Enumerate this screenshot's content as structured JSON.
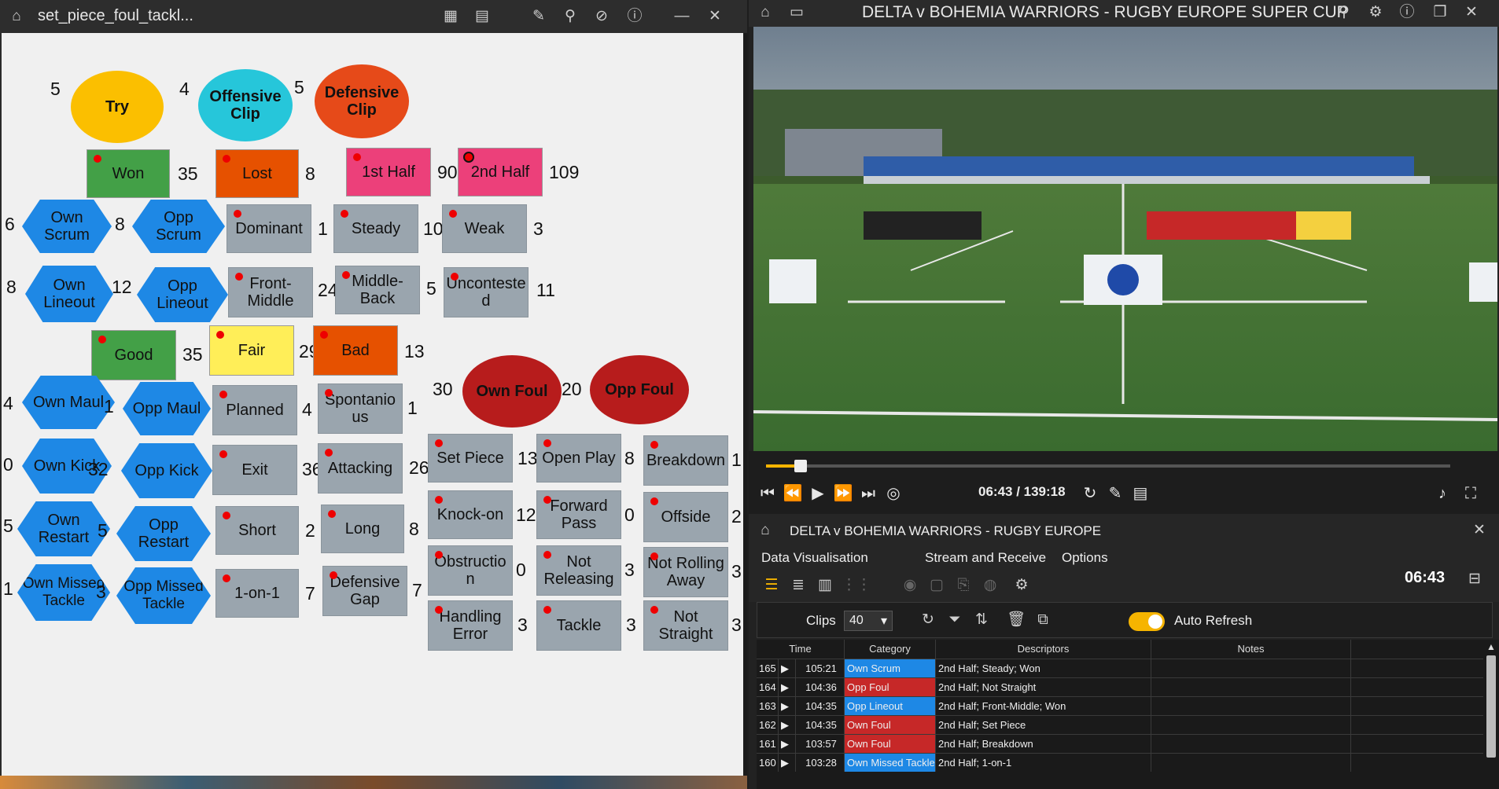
{
  "left_window": {
    "title": "set_piece_foul_tackl...",
    "tags": [
      {
        "label": "Try",
        "count": "5"
      },
      {
        "label": "Offensive\nClip",
        "count": "4"
      },
      {
        "label": "Defensive\nClip",
        "count": "5"
      },
      {
        "label": "Won",
        "count": "35"
      },
      {
        "label": "Lost",
        "count": "8"
      },
      {
        "label": "1st Half",
        "count": "90"
      },
      {
        "label": "2nd Half",
        "count": "109"
      },
      {
        "label": "Own Scrum",
        "count": "6"
      },
      {
        "label": "Opp Scrum",
        "count": "8"
      },
      {
        "label": "Dominant",
        "count": "1"
      },
      {
        "label": "Steady",
        "count": "10"
      },
      {
        "label": "Weak",
        "count": "3"
      },
      {
        "label": "Own\nLineout",
        "count": "8"
      },
      {
        "label": "Opp Lineout",
        "count": "12"
      },
      {
        "label": "Front-\nMiddle",
        "count": "24"
      },
      {
        "label": "Middle-\nBack",
        "count": "5"
      },
      {
        "label": "Unconteste\nd",
        "count": "11"
      },
      {
        "label": "Good",
        "count": "35"
      },
      {
        "label": "Fair",
        "count": "29"
      },
      {
        "label": "Bad",
        "count": "13"
      },
      {
        "label": "Own Foul",
        "count": "30"
      },
      {
        "label": "Opp Foul",
        "count": "20"
      },
      {
        "label": "Own Maul",
        "count": "4"
      },
      {
        "label": "Opp Maul",
        "count": "1"
      },
      {
        "label": "Planned",
        "count": "4"
      },
      {
        "label": "Spontanio\nus",
        "count": "1"
      },
      {
        "label": "Own Kick",
        "count": "0"
      },
      {
        "label": "Opp Kick",
        "count": "32"
      },
      {
        "label": "Exit",
        "count": "36"
      },
      {
        "label": "Attacking",
        "count": "26"
      },
      {
        "label": "Set Piece",
        "count": "13"
      },
      {
        "label": "Open Play",
        "count": "8"
      },
      {
        "label": "Breakdown",
        "count": "1"
      },
      {
        "label": "Own Restart",
        "count": "5"
      },
      {
        "label": "Opp Restart",
        "count": "5"
      },
      {
        "label": "Short",
        "count": "2"
      },
      {
        "label": "Long",
        "count": "8"
      },
      {
        "label": "Knock-on",
        "count": "12"
      },
      {
        "label": "Forward\nPass",
        "count": "0"
      },
      {
        "label": "Offside",
        "count": "2"
      },
      {
        "label": "Own Missed\nTackle",
        "count": "1"
      },
      {
        "label": "Opp Missed\nTackle",
        "count": "3"
      },
      {
        "label": "1-on-1",
        "count": "7"
      },
      {
        "label": "Defensive\nGap",
        "count": "7"
      },
      {
        "label": "Obstructio\nn",
        "count": "0"
      },
      {
        "label": "Not\nReleasing",
        "count": "3"
      },
      {
        "label": "Not Rolling\nAway",
        "count": "3"
      },
      {
        "label": "Handling\nError",
        "count": "3"
      },
      {
        "label": "Tackle",
        "count": "3"
      },
      {
        "label": "Not\nStraight",
        "count": "3"
      }
    ]
  },
  "video_window": {
    "title": "DELTA v BOHEMIA WARRIORS - RUGBY EUROPE SUPER CUP",
    "time_display": "06:43 / 139:18",
    "progress": 0.05
  },
  "data_vis": {
    "title": "DELTA v BOHEMIA WARRIORS - RUGBY EUROPE",
    "menus": [
      "Data Visualisation",
      "Stream and Receive",
      "Options"
    ],
    "clock": "06:43",
    "clips_label": "Clips",
    "clips_value": "40",
    "auto_refresh_label": "Auto Refresh",
    "columns": [
      "Time",
      "Category",
      "Descriptors",
      "Notes"
    ],
    "rows": [
      {
        "id": "165",
        "time": "105:21",
        "category": "Own Scrum",
        "cat_color": "#1e88e5",
        "descriptors": "2nd Half; Steady; Won",
        "notes": ""
      },
      {
        "id": "164",
        "time": "104:36",
        "category": "Opp Foul",
        "cat_color": "#c62828",
        "descriptors": "2nd Half; Not Straight",
        "notes": ""
      },
      {
        "id": "163",
        "time": "104:35",
        "category": "Opp Lineout",
        "cat_color": "#1e88e5",
        "descriptors": "2nd Half; Front-Middle; Won",
        "notes": ""
      },
      {
        "id": "162",
        "time": "104:35",
        "category": "Own Foul",
        "cat_color": "#c62828",
        "descriptors": "2nd Half; Set Piece",
        "notes": ""
      },
      {
        "id": "161",
        "time": "103:57",
        "category": "Own Foul",
        "cat_color": "#c62828",
        "descriptors": "2nd Half; Breakdown",
        "notes": ""
      },
      {
        "id": "160",
        "time": "103:28",
        "category": "Own Missed Tackle",
        "cat_color": "#1e88e5",
        "descriptors": "2nd Half; 1-on-1",
        "notes": ""
      }
    ]
  },
  "colors": {
    "accent": "#f6b400",
    "blue": "#1e88e5",
    "red": "#c62828",
    "green": "#43a047",
    "orange": "#e65100",
    "pink": "#ec407a",
    "yellow": "#ffee58",
    "cyan": "#26c6da",
    "gray": "#9aa5ae"
  }
}
